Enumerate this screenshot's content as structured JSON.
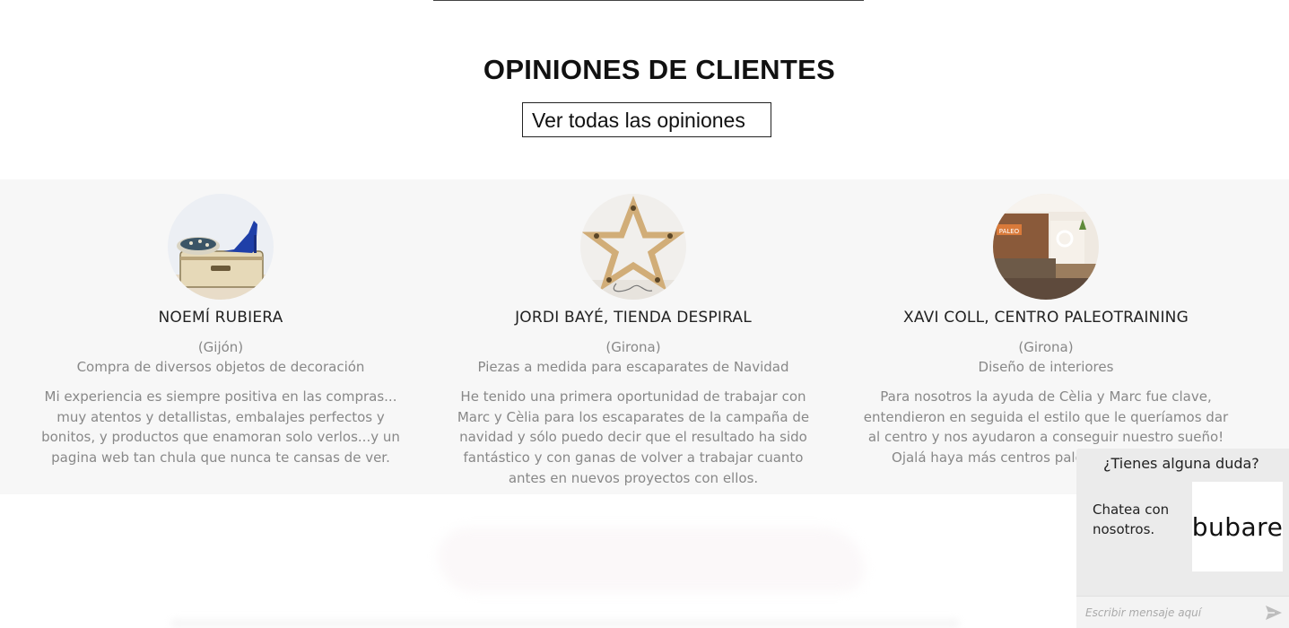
{
  "section": {
    "title": "OPINIONES DE CLIENTES",
    "view_all_label": "Ver todas las opiniones"
  },
  "reviews": [
    {
      "name": "NOEMÍ RUBIERA",
      "city": "(Gijón)",
      "subject": "Compra de diversos objetos de decoración",
      "quote": "Mi experiencia es siempre positiva en las compras... muy atentos y detallistas, embalajes perfectos y bonitos, y productos que enamoran solo verlos...y un pagina web tan chula que nunca te cansas de ver.",
      "avatar_icon": "suitcase-shoe-photo"
    },
    {
      "name": "JORDI BAYÉ, TIENDA DESPIRAL",
      "city": "(Girona)",
      "subject": "Piezas a medida para escaparates de Navidad",
      "quote": "He tenido una primera oportunidad de trabajar con Marc y Cèlia para los escaparates de la campaña de navidad y sólo puedo decir que el resultado ha sido fantástico y con ganas de volver a trabajar cuanto antes en nuevos proyectos con ellos.",
      "avatar_icon": "wooden-star-lamp-photo"
    },
    {
      "name": "XAVI COLL, CENTRO PALEOTRAINING",
      "city": "(Girona)",
      "subject": "Diseño de interiores",
      "quote": "Para nosotros la ayuda de Cèlia y Marc fue clave, entendieron en seguida el estilo que le queríamos dar al centro y nos ayudaron a conseguir nuestro sueño! Ojalá haya más centros paleos, sin duda les v",
      "avatar_icon": "gym-interior-photo"
    }
  ],
  "chat": {
    "title": "¿Tienes alguna duda?",
    "message": "Chatea con nosotros.",
    "logo_text": "bubare",
    "input_placeholder": "Escribir mensaje aquí",
    "send_icon": "send-arrow-icon"
  },
  "colors": {
    "band_background": "#f7f7f7",
    "chat_background": "#ebebeb",
    "muted_text": "#888888"
  }
}
